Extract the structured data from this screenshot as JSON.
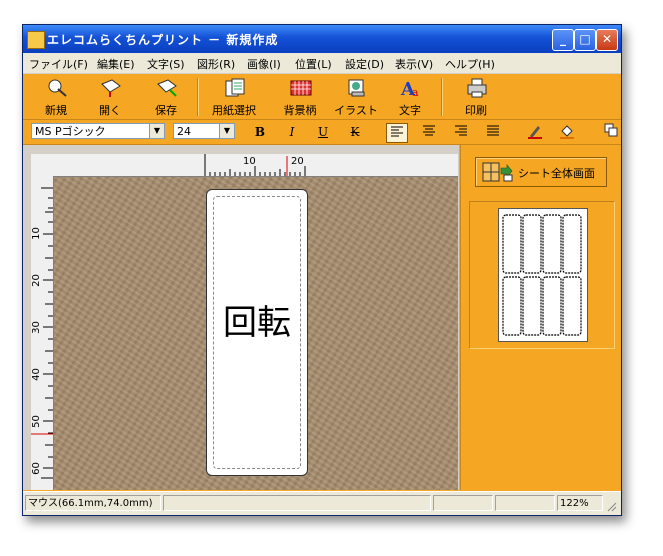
{
  "window": {
    "title": "エレコムらくちんプリント － 新規作成"
  },
  "menu": [
    "ファイル(F)",
    "編集(E)",
    "文字(S)",
    "図形(R)",
    "画像(I)",
    "位置(L)",
    "設定(D)",
    "表示(V)",
    "ヘルプ(H)"
  ],
  "toolbar": {
    "new": "新規",
    "open": "開く",
    "save": "保存",
    "paper": "用紙選択",
    "background": "背景柄",
    "illust": "イラスト",
    "text": "文字",
    "print": "印刷"
  },
  "format": {
    "font": "MS Pゴシック",
    "size": "24",
    "bold": "B",
    "italic": "I",
    "underline": "U",
    "strike": "K"
  },
  "ruler": {
    "top": [
      "10",
      "20"
    ],
    "left": [
      "10",
      "20",
      "30",
      "40",
      "50",
      "60"
    ]
  },
  "label": {
    "text": "回転"
  },
  "panel": {
    "sheet_button": "シート全体画面"
  },
  "status": {
    "mouse": "マウス(66.1mm,74.0mm)",
    "zoom": "122%"
  },
  "colors": {
    "accent": "#f5a623",
    "title": "#1451d6",
    "desk": "#a88d6e"
  }
}
